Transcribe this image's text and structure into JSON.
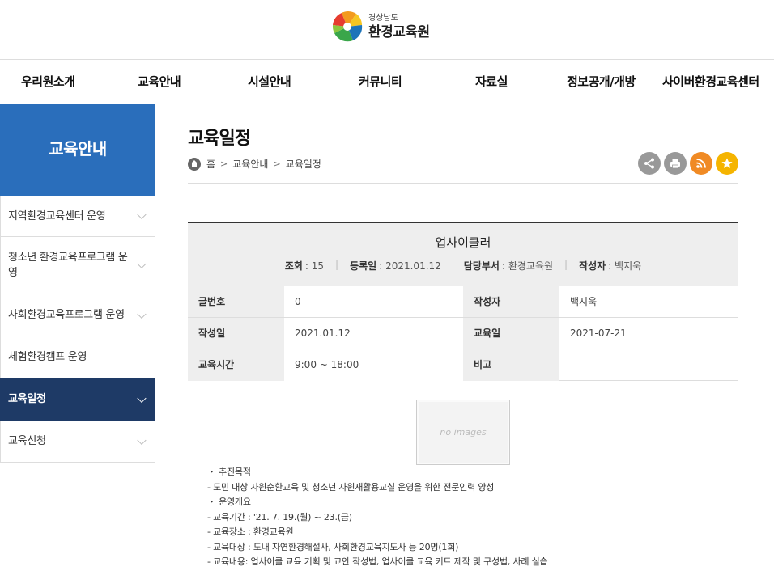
{
  "header": {
    "logo_sub": "경상남도",
    "logo_main": "환경교육원"
  },
  "gnb": [
    {
      "label": "우리원소개"
    },
    {
      "label": "교육안내"
    },
    {
      "label": "시설안내"
    },
    {
      "label": "커뮤니티"
    },
    {
      "label": "자료실"
    },
    {
      "label": "정보공개/개방"
    },
    {
      "label": "사이버환경교육센터"
    }
  ],
  "sidebar": {
    "title": "교육안내",
    "items": [
      {
        "label": "지역환경교육센터 운영",
        "chevron": true
      },
      {
        "label": "청소년 환경교육프로그램 운영",
        "chevron": true
      },
      {
        "label": "사회환경교육프로그램 운영",
        "chevron": true
      },
      {
        "label": "체험환경캠프 운영",
        "chevron": false
      },
      {
        "label": "교육일정",
        "chevron": true,
        "active": true
      },
      {
        "label": "교육신청",
        "chevron": true
      }
    ]
  },
  "page": {
    "title": "교육일정",
    "breadcrumb": [
      "홈",
      "교육안내",
      "교육일정"
    ]
  },
  "tools": [
    {
      "icon": "share-icon",
      "color": "#999999"
    },
    {
      "icon": "print-icon",
      "color": "#999999"
    },
    {
      "icon": "rss-icon",
      "color": "#f08a24"
    },
    {
      "icon": "star-icon",
      "color": "#f5b400"
    }
  ],
  "post": {
    "title": "업사이클러",
    "meta": {
      "views_label": "조회",
      "views": ": 15",
      "date_label": "등록일",
      "date": ": 2021.01.12",
      "dept_label": "담당부서",
      "dept": ": 환경교육원",
      "author_label": "작성자",
      "author": ": 백지욱"
    },
    "rows": [
      {
        "th1": "글번호",
        "td1": "0",
        "th2": "작성자",
        "td2": "백지욱"
      },
      {
        "th1": "작성일",
        "td1": "2021.01.12",
        "th2": "교육일",
        "td2": "2021-07-21"
      },
      {
        "th1": "교육시간",
        "td1": "9:00 ~ 18:00",
        "th2": "비고",
        "td2": ""
      }
    ],
    "no_image": "no images",
    "body": [
      " ・ 추진목적",
      "- 도민 대상 자원순환교육 및 청소년 자원재활용교실 운영을 위한 전문인력 양성",
      " ・ 운영개요",
      "  - 교육기간 : '21. 7. 19.(월) ~ 23.(금)",
      "  - 교육장소 : 환경교육원",
      "  - 교육대상 : 도내 자연환경해설사, 사회환경교육지도사 등 20명(1회)",
      "  - 교육내용: 업사이클 교육 기획 및 교안 작성법, 업사이클 교육 키트 제작 및 구성법, 사례 실습"
    ]
  }
}
